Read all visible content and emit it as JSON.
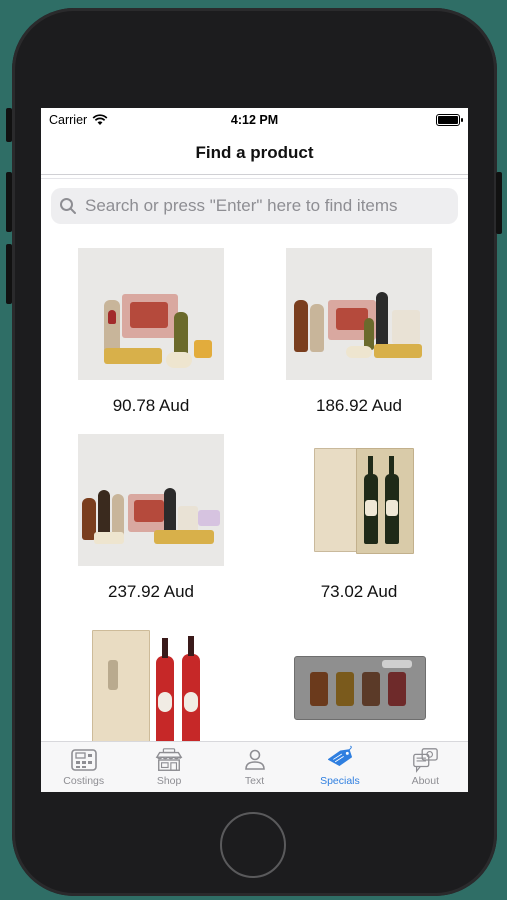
{
  "status": {
    "carrier": "Carrier",
    "time": "4:12 PM"
  },
  "header": {
    "title": "Find a product"
  },
  "search": {
    "placeholder": "Search or press \"Enter\" here to find items"
  },
  "products": [
    {
      "price": "90.78 Aud"
    },
    {
      "price": "186.92 Aud"
    },
    {
      "price": "237.92 Aud"
    },
    {
      "price": "73.02 Aud"
    },
    {
      "price": ""
    },
    {
      "price": ""
    }
  ],
  "tabs": [
    {
      "label": "Costings",
      "icon": "calculator-icon"
    },
    {
      "label": "Shop",
      "icon": "store-icon"
    },
    {
      "label": "Text",
      "icon": "person-icon"
    },
    {
      "label": "Specials",
      "icon": "tag-icon",
      "active": true
    },
    {
      "label": "About",
      "icon": "info-chat-icon"
    }
  ],
  "colors": {
    "accent": "#2f7fe0",
    "background": "#2f6e66"
  }
}
